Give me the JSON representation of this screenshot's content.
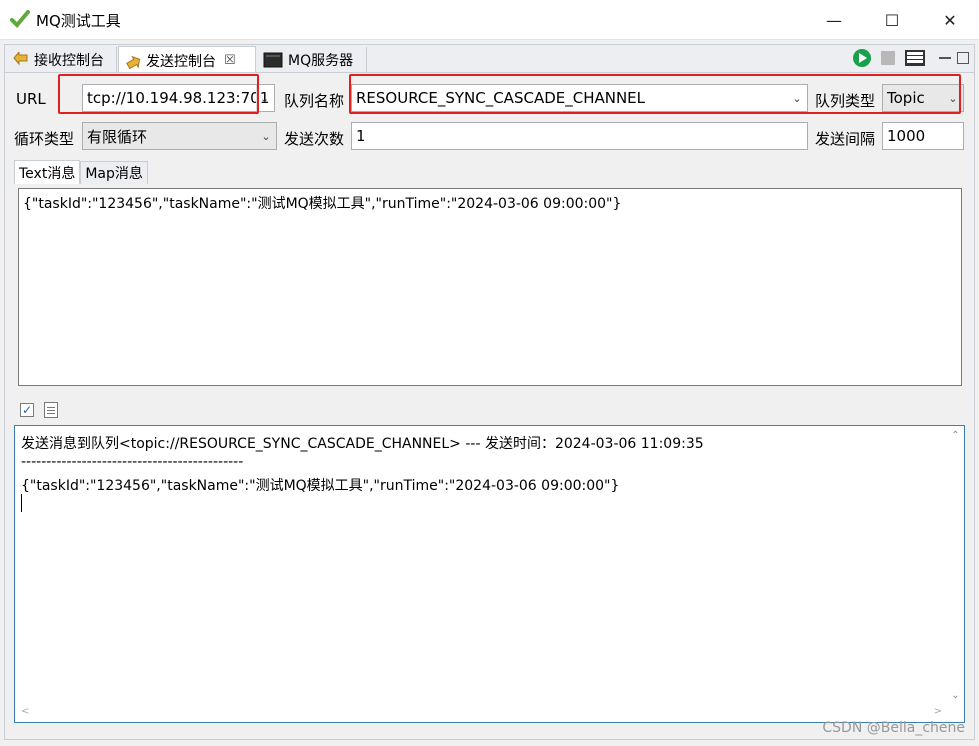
{
  "window": {
    "title": "MQ测试工具"
  },
  "tabs": [
    {
      "label": "接收控制台"
    },
    {
      "label": "发送控制台",
      "close": "☒"
    },
    {
      "label": "MQ服务器"
    }
  ],
  "form": {
    "url_label": "URL",
    "url_value": "tcp://10.194.98.123:701",
    "queue_name_label": "队列名称",
    "queue_name_value": "RESOURCE_SYNC_CASCADE_CHANNEL",
    "queue_type_label": "队列类型",
    "queue_type_value": "Topic",
    "loop_type_label": "循环类型",
    "loop_type_value": "有限循环",
    "send_count_label": "发送次数",
    "send_count_value": "1",
    "send_interval_label": "发送间隔",
    "send_interval_value": "1000"
  },
  "message_tabs": [
    {
      "label": "Text消息"
    },
    {
      "label": "Map消息"
    }
  ],
  "message_body": "{\"taskId\":\"123456\",\"taskName\":\"测试MQ模拟工具\",\"runTime\":\"2024-03-06 09:00:00\"}",
  "log": {
    "line1": "发送消息到队列<topic://RESOURCE_SYNC_CASCADE_CHANNEL> --- 发送时间：2024-03-06 11:09:35",
    "line2": "--------------------------------------------",
    "line3": "{\"taskId\":\"123456\",\"taskName\":\"测试MQ模拟工具\",\"runTime\":\"2024-03-06 09:00:00\"}"
  },
  "watermark": "CSDN @Bella_chene",
  "colors": {
    "highlight_box": "#e02020",
    "play_green": "#1aa04a",
    "active_border": "#3c7fb1"
  }
}
